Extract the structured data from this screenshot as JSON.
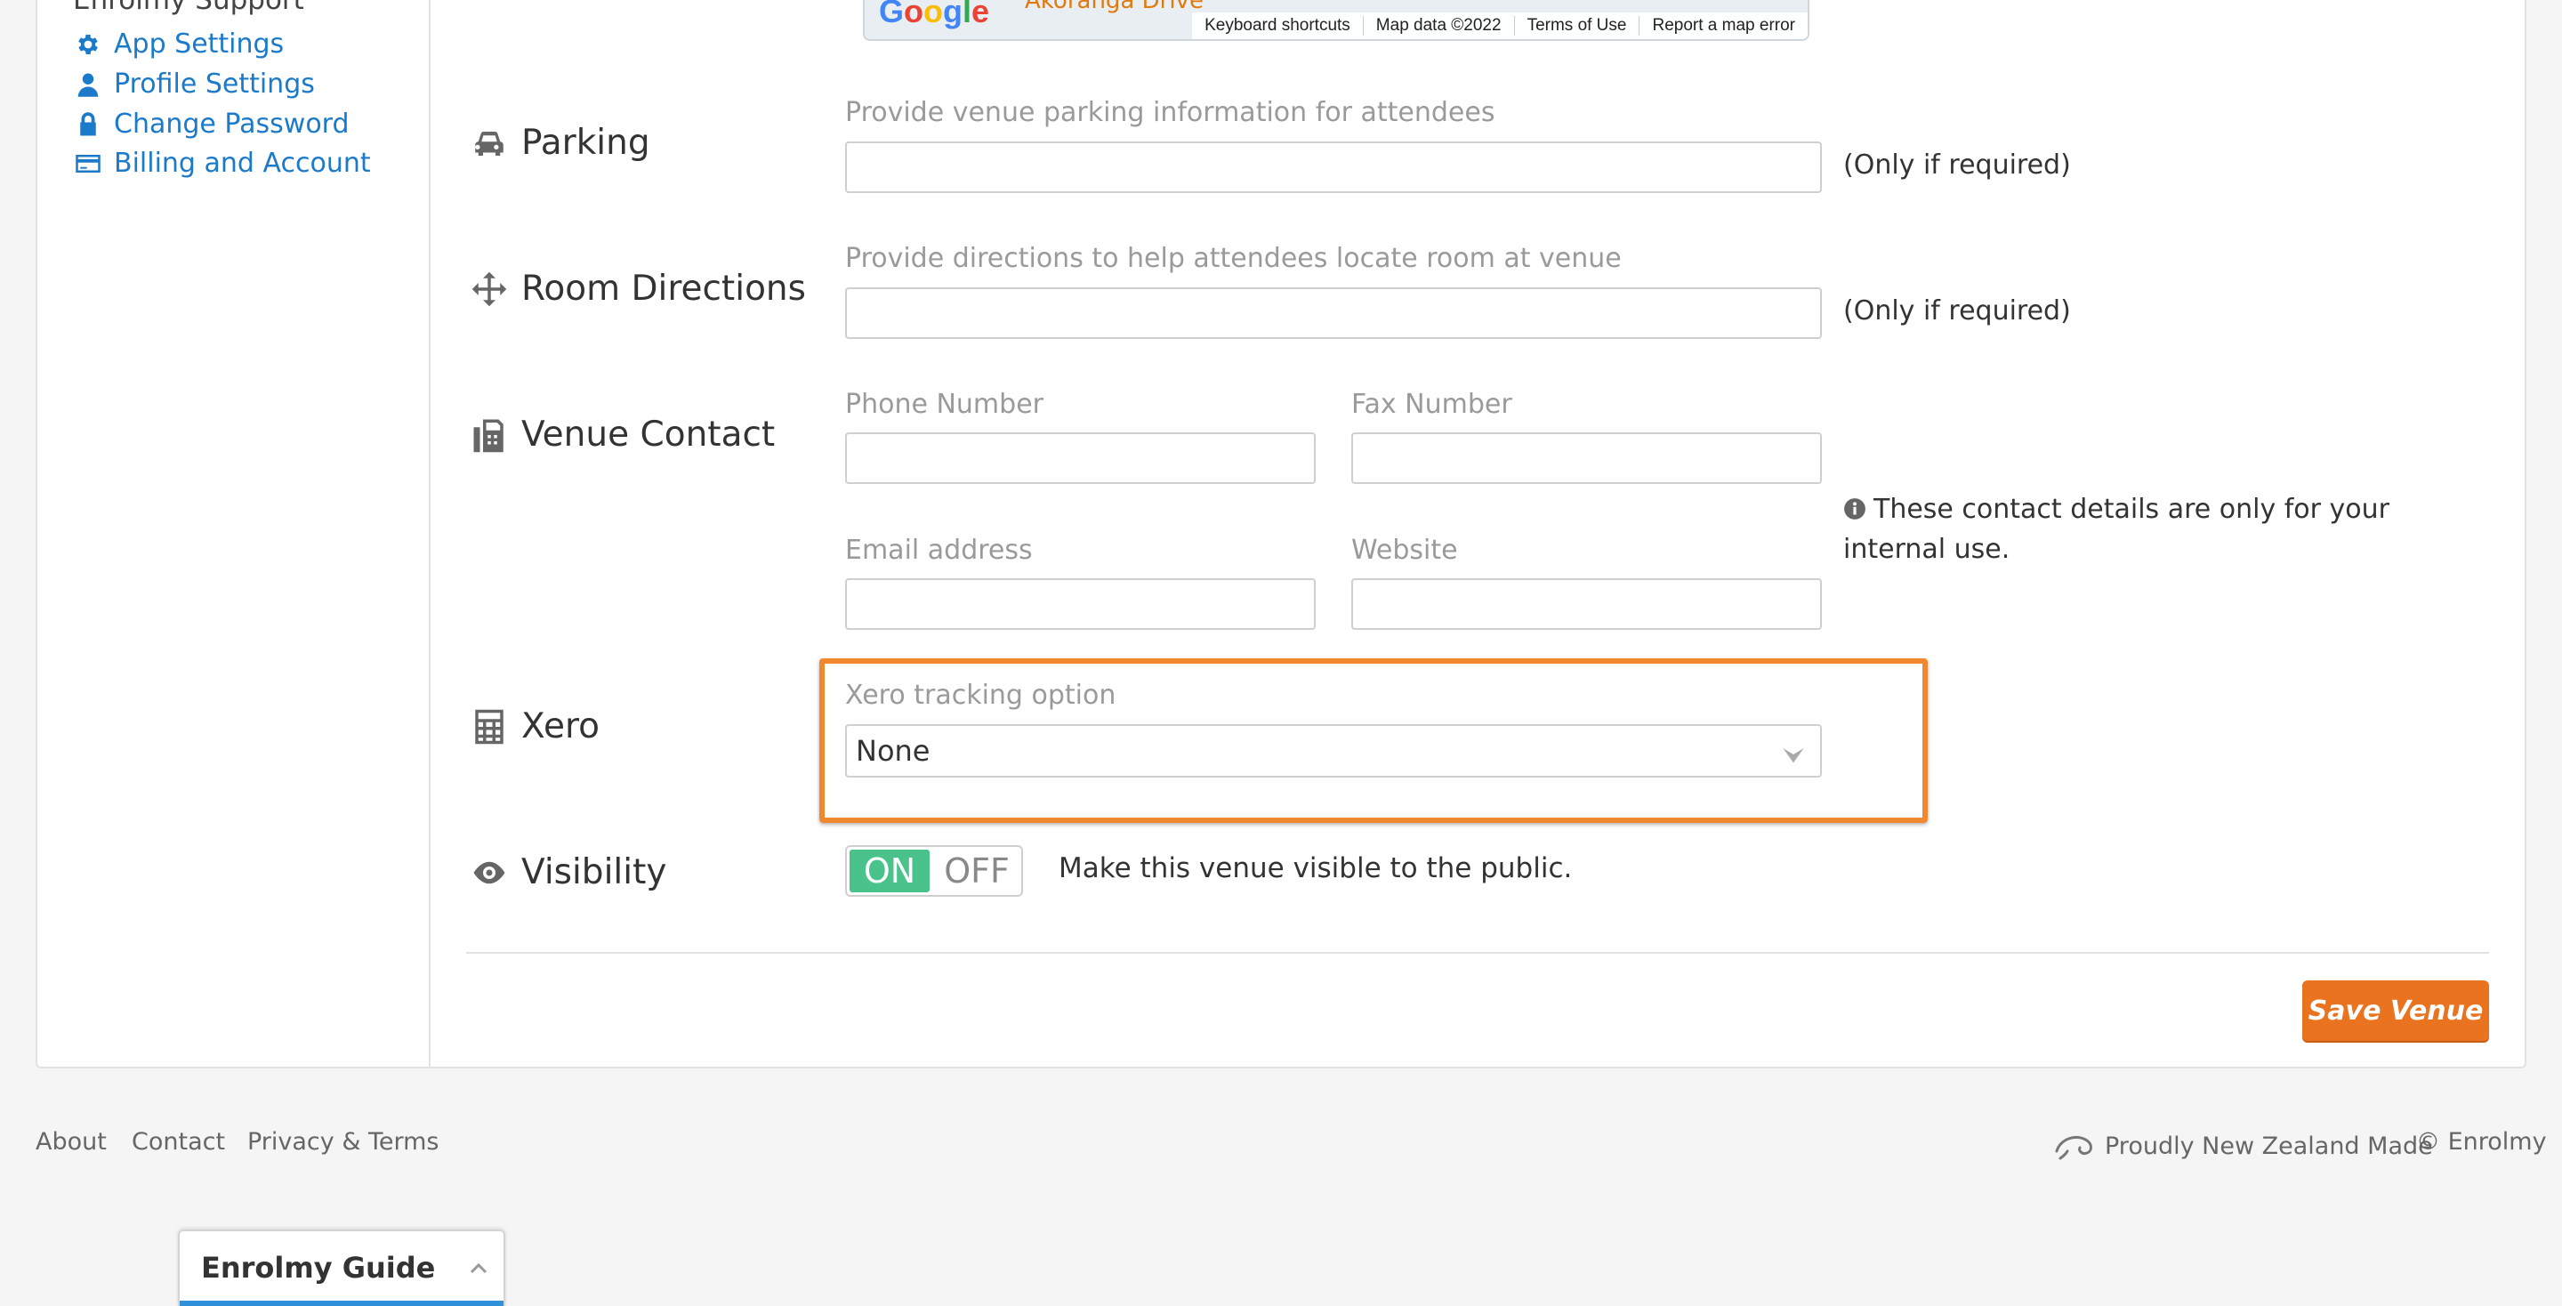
{
  "sidebar": {
    "title": "Enrolmy Support",
    "links": [
      {
        "label": "App Settings",
        "icon": "gear-icon"
      },
      {
        "label": "Profile Settings",
        "icon": "user-icon"
      },
      {
        "label": "Change Password",
        "icon": "lock-icon"
      },
      {
        "label": "Billing and Account",
        "icon": "credit-card-icon"
      }
    ]
  },
  "map": {
    "logo": "Google",
    "road_label": "Akoranga Drive",
    "attribution": [
      "Keyboard shortcuts",
      "Map data ©2022",
      "Terms of Use",
      "Report a map error"
    ]
  },
  "form": {
    "parking": {
      "label": "Parking",
      "hint": "Provide venue parking information for attendees",
      "value": "",
      "note": "(Only if required)"
    },
    "room_directions": {
      "label": "Room Directions",
      "hint": "Provide directions to help attendees locate room at venue",
      "value": "",
      "note": "(Only if required)"
    },
    "venue_contact": {
      "label": "Venue Contact",
      "phone_label": "Phone Number",
      "fax_label": "Fax Number",
      "email_label": "Email address",
      "website_label": "Website",
      "info": "These contact details are only for your internal use."
    },
    "xero": {
      "label": "Xero",
      "tracking_label": "Xero tracking option",
      "selected": "None"
    },
    "visibility": {
      "label": "Visibility",
      "on_label": "ON",
      "off_label": "OFF",
      "state": "ON",
      "description": "Make this venue visible to the public."
    },
    "save_label": "Save Venue"
  },
  "footer": {
    "links": [
      "About",
      "Contact",
      "Privacy & Terms"
    ],
    "made_in": "Proudly New Zealand Made",
    "copyright": "© Enrolmy"
  },
  "guide_widget": {
    "title": "Enrolmy Guide"
  },
  "colors": {
    "link": "#1b7ac9",
    "accent_orange": "#ea7320",
    "highlight_border": "#f0882f",
    "toggle_on": "#4ac28b",
    "guide_bar": "#2f8fd8"
  }
}
